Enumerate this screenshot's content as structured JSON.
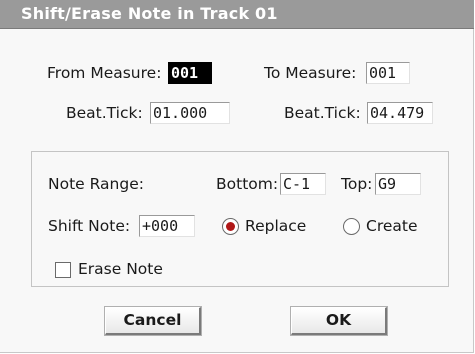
{
  "dialog": {
    "title": "Shift/Erase Note in Track 01"
  },
  "measure": {
    "from_label": "From Measure:",
    "from_value": "001",
    "to_label": "To Measure:",
    "to_value": "001",
    "from_beat_label": "Beat.Tick:",
    "from_beat_value": "01.000",
    "to_beat_label": "Beat.Tick:",
    "to_beat_value": "04.479"
  },
  "note_range": {
    "label": "Note Range:",
    "bottom_label": "Bottom:",
    "bottom_value": "C-1",
    "top_label": "Top:",
    "top_value": "G9"
  },
  "shift": {
    "label": "Shift Note:",
    "value": "+000",
    "mode_options": [
      {
        "label": "Replace",
        "selected": true
      },
      {
        "label": "Create",
        "selected": false
      }
    ]
  },
  "erase": {
    "label": "Erase Note",
    "checked": false
  },
  "buttons": {
    "cancel": "Cancel",
    "ok": "OK"
  },
  "colors": {
    "title_bar": "#9a9a9a",
    "radio_selected": "#b01818",
    "selected_field": "#000000"
  }
}
